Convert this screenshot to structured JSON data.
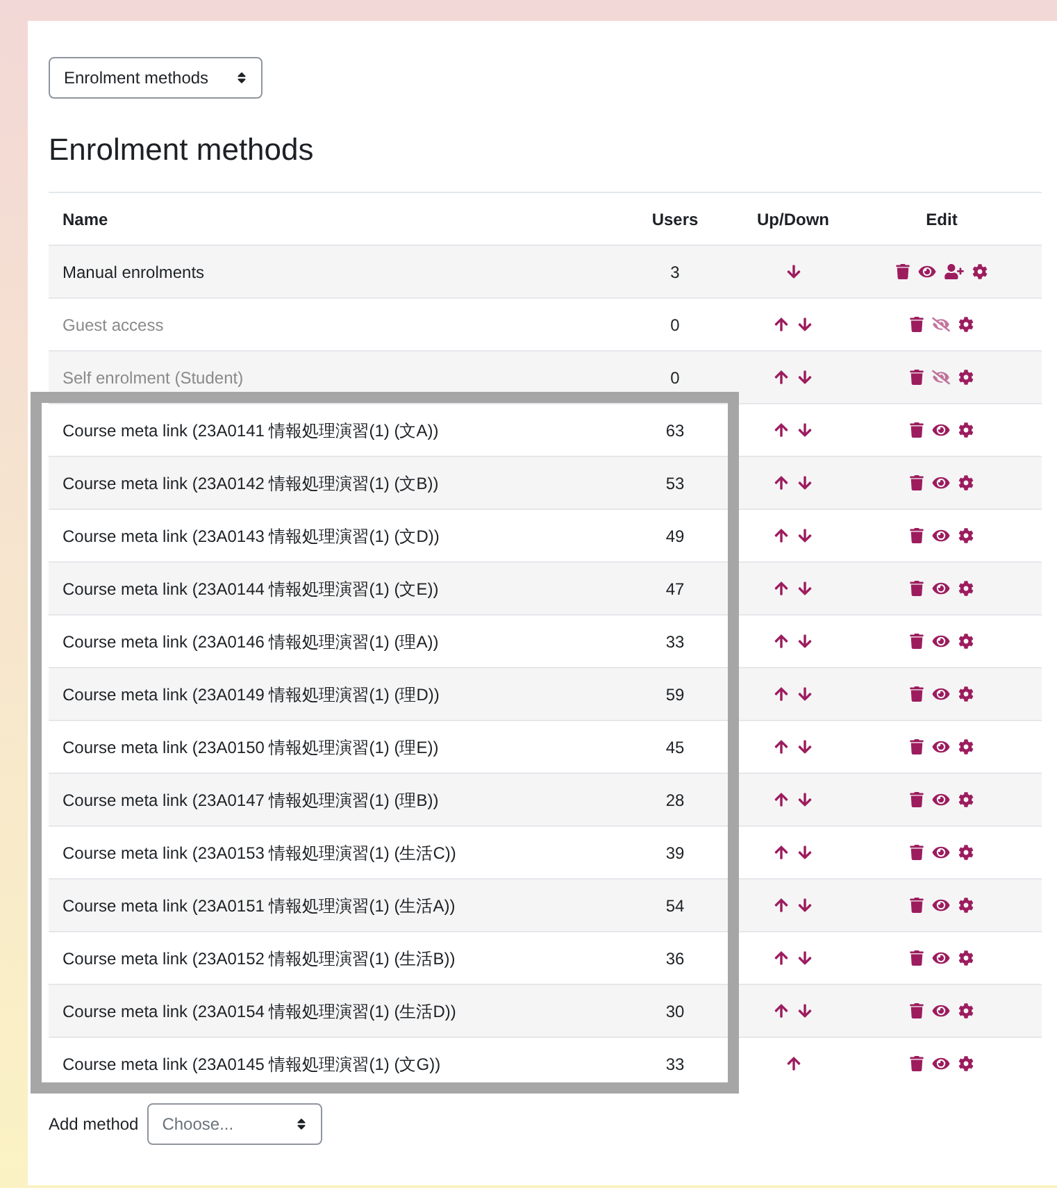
{
  "page_select": {
    "value": "Enrolment methods"
  },
  "heading": "Enrolment methods",
  "table": {
    "columns": [
      "Name",
      "Users",
      "Up/Down",
      "Edit"
    ],
    "rows": [
      {
        "name": "Manual enrolments",
        "users": "3",
        "disabled": false,
        "up": false,
        "down": true,
        "enrol_users": true,
        "highlighted": false
      },
      {
        "name": "Guest access",
        "users": "0",
        "disabled": true,
        "up": true,
        "down": true,
        "enrol_users": false,
        "highlighted": false
      },
      {
        "name": "Self enrolment (Student)",
        "users": "0",
        "disabled": true,
        "up": true,
        "down": true,
        "enrol_users": false,
        "highlighted": false
      },
      {
        "name": "Course meta link (23A0141 情報処理演習(1) (文A))",
        "users": "63",
        "disabled": false,
        "up": true,
        "down": true,
        "enrol_users": false,
        "highlighted": true
      },
      {
        "name": "Course meta link (23A0142 情報処理演習(1) (文B))",
        "users": "53",
        "disabled": false,
        "up": true,
        "down": true,
        "enrol_users": false,
        "highlighted": true
      },
      {
        "name": "Course meta link (23A0143 情報処理演習(1) (文D))",
        "users": "49",
        "disabled": false,
        "up": true,
        "down": true,
        "enrol_users": false,
        "highlighted": true
      },
      {
        "name": "Course meta link (23A0144 情報処理演習(1) (文E))",
        "users": "47",
        "disabled": false,
        "up": true,
        "down": true,
        "enrol_users": false,
        "highlighted": true
      },
      {
        "name": "Course meta link (23A0146 情報処理演習(1) (理A))",
        "users": "33",
        "disabled": false,
        "up": true,
        "down": true,
        "enrol_users": false,
        "highlighted": true
      },
      {
        "name": "Course meta link (23A0149 情報処理演習(1) (理D))",
        "users": "59",
        "disabled": false,
        "up": true,
        "down": true,
        "enrol_users": false,
        "highlighted": true
      },
      {
        "name": "Course meta link (23A0150 情報処理演習(1) (理E))",
        "users": "45",
        "disabled": false,
        "up": true,
        "down": true,
        "enrol_users": false,
        "highlighted": true
      },
      {
        "name": "Course meta link (23A0147 情報処理演習(1) (理B))",
        "users": "28",
        "disabled": false,
        "up": true,
        "down": true,
        "enrol_users": false,
        "highlighted": true
      },
      {
        "name": "Course meta link (23A0153 情報処理演習(1) (生活C))",
        "users": "39",
        "disabled": false,
        "up": true,
        "down": true,
        "enrol_users": false,
        "highlighted": true
      },
      {
        "name": "Course meta link (23A0151 情報処理演習(1) (生活A))",
        "users": "54",
        "disabled": false,
        "up": true,
        "down": true,
        "enrol_users": false,
        "highlighted": true
      },
      {
        "name": "Course meta link (23A0152 情報処理演習(1) (生活B))",
        "users": "36",
        "disabled": false,
        "up": true,
        "down": true,
        "enrol_users": false,
        "highlighted": true
      },
      {
        "name": "Course meta link (23A0154 情報処理演習(1) (生活D))",
        "users": "30",
        "disabled": false,
        "up": true,
        "down": true,
        "enrol_users": false,
        "highlighted": true
      },
      {
        "name": "Course meta link (23A0145 情報処理演習(1) (文G))",
        "users": "33",
        "disabled": false,
        "up": true,
        "down": false,
        "enrol_users": false,
        "highlighted": true
      }
    ]
  },
  "add_method": {
    "label": "Add method",
    "placeholder": "Choose..."
  }
}
